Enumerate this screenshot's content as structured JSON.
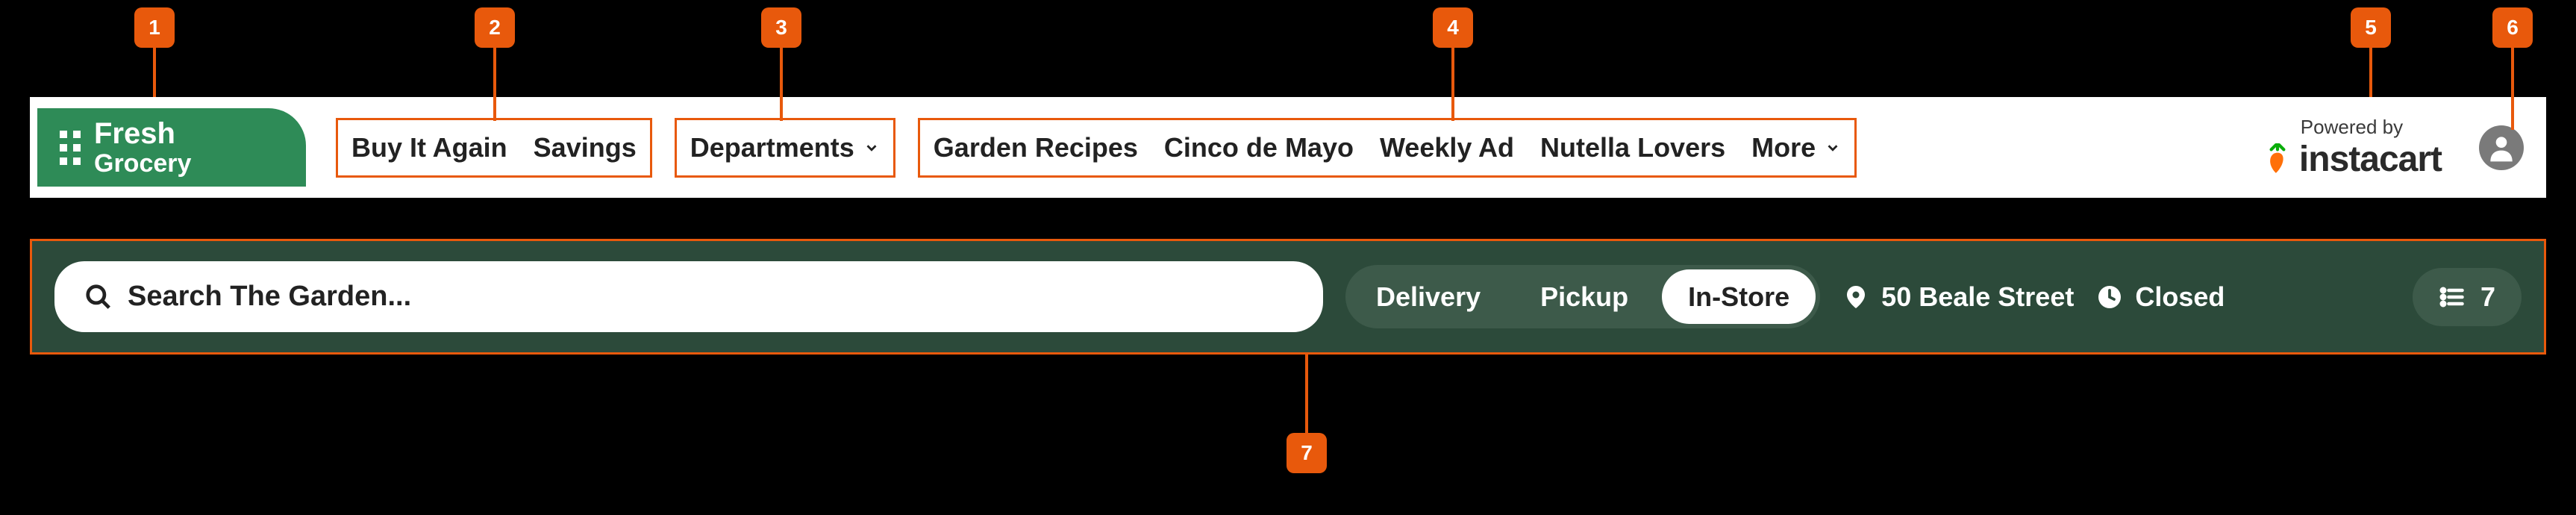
{
  "annotations": [
    "1",
    "2",
    "3",
    "4",
    "5",
    "6",
    "7"
  ],
  "logo": {
    "line1": "Fresh",
    "line2": "Grocery"
  },
  "nav": {
    "shortcuts": [
      "Buy It Again",
      "Savings"
    ],
    "departments_label": "Departments",
    "collections": [
      "Garden Recipes",
      "Cinco de Mayo",
      "Weekly Ad",
      "Nutella Lovers"
    ],
    "more_label": "More"
  },
  "powered_by": {
    "label": "Powered by",
    "brand": "instacart"
  },
  "search": {
    "placeholder": "Search The Garden..."
  },
  "modes": {
    "options": [
      "Delivery",
      "Pickup",
      "In-Store"
    ],
    "active": "In-Store"
  },
  "location": {
    "address": "50 Beale Street"
  },
  "hours": {
    "status": "Closed"
  },
  "list": {
    "count": "7"
  }
}
